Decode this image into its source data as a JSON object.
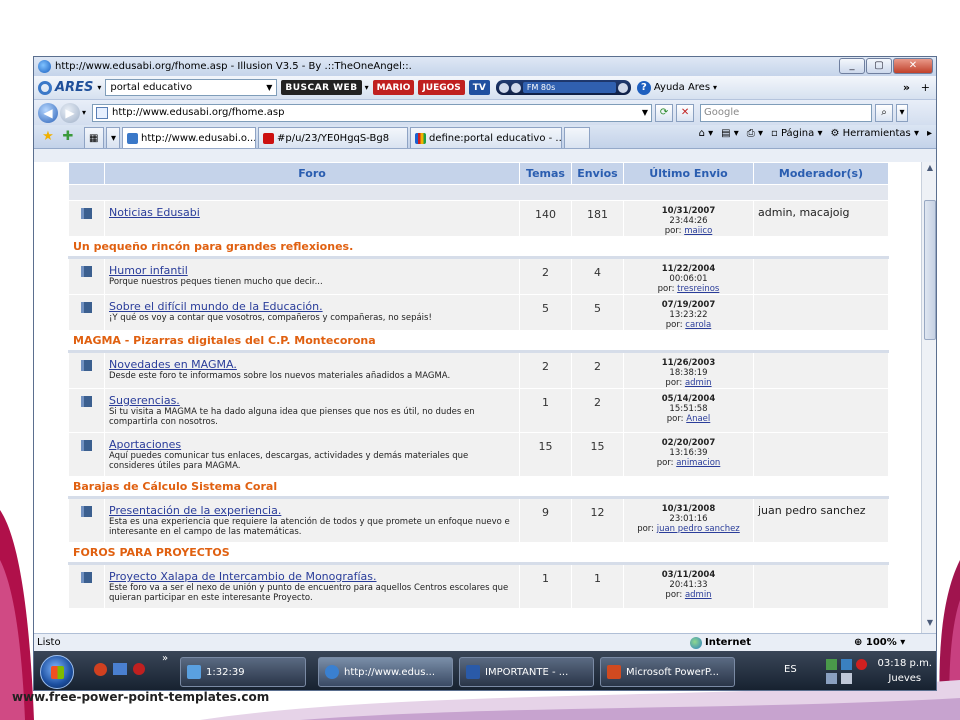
{
  "window": {
    "title": "http://www.edusabi.org/fhome.asp - Illusion V3.5 - By .::TheOneAngel::.",
    "controls": [
      "_",
      "▢",
      "✕"
    ]
  },
  "ares_toolbar": {
    "logo": "ARES",
    "search_value": "portal educativo",
    "buscar_label": "BUSCAR WEB",
    "mario_label": "MARIO",
    "juegos_label": "JUEGOS",
    "tv_label": "TV",
    "radio_station": "FM 80s",
    "help_label": "Ayuda Ares"
  },
  "address_bar": {
    "url": "http://www.edusabi.org/fhome.asp",
    "search_placeholder": "Google"
  },
  "tabs": [
    {
      "label": "http://www.edusabi.o...",
      "active": true
    },
    {
      "label": "#p/u/23/YE0HgqS-Bg8",
      "active": false
    },
    {
      "label": "define:portal educativo - ...",
      "active": false
    }
  ],
  "command_bar": {
    "page_label": "Página",
    "tools_label": "Herramientas"
  },
  "forum": {
    "headers": {
      "forum": "Foro",
      "topics": "Temas",
      "posts": "Envios",
      "last": "Último Envio",
      "moderator": "Moderador(s)"
    },
    "rows": [
      {
        "type": "forum",
        "title": "Noticias Edusabi",
        "desc": "",
        "topics": "140",
        "posts": "181",
        "date": "10/31/2007",
        "time": "23:44:26",
        "by_prefix": "por:",
        "by": "maiico",
        "moderator": "admin, macajoig"
      },
      {
        "type": "category",
        "title": "Un pequeño rincón para grandes reflexiones."
      },
      {
        "type": "forum",
        "title": "Humor infantil",
        "desc": "Porque nuestros peques tienen mucho que decir...",
        "topics": "2",
        "posts": "4",
        "date": "11/22/2004",
        "time": "00:06:01",
        "by_prefix": "por:",
        "by": "tresreinos",
        "moderator": ""
      },
      {
        "type": "forum",
        "title": "Sobre el difícil mundo de la Educación.",
        "desc": "¡Y qué os voy a contar que vosotros, compañeros y compañeras, no sepáis!",
        "topics": "5",
        "posts": "5",
        "date": "07/19/2007",
        "time": "13:23:22",
        "by_prefix": "por:",
        "by": "carola",
        "moderator": ""
      },
      {
        "type": "category",
        "title": "MAGMA - Pizarras digitales del C.P. Montecorona"
      },
      {
        "type": "forum",
        "title": "Novedades en MAGMA.",
        "desc": "Desde este foro te informamos sobre los nuevos materiales añadidos a MAGMA.",
        "topics": "2",
        "posts": "2",
        "date": "11/26/2003",
        "time": "18:38:19",
        "by_prefix": "por:",
        "by": "admin",
        "moderator": ""
      },
      {
        "type": "forum",
        "title": "Sugerencias.",
        "desc": "Si tu visita a MAGMA te ha dado alguna idea que pienses que nos es útil, no dudes en compartirla con nosotros.",
        "topics": "1",
        "posts": "2",
        "date": "05/14/2004",
        "time": "15:51:58",
        "by_prefix": "por:",
        "by": "Anael",
        "moderator": ""
      },
      {
        "type": "forum",
        "title": "Aportaciones",
        "desc": "Aquí puedes comunicar tus enlaces, descargas, actividades y demás materiales que consideres útiles para MAGMA.",
        "topics": "15",
        "posts": "15",
        "date": "02/20/2007",
        "time": "13:16:39",
        "by_prefix": "por:",
        "by": "animacion",
        "moderator": ""
      },
      {
        "type": "category",
        "title": "Barajas de Cálculo Sistema Coral"
      },
      {
        "type": "forum",
        "title": "Presentación de la experiencia.",
        "desc": "Esta es una experiencia que requiere la atención de todos y que promete un enfoque nuevo e interesante en el campo de las matemáticas.",
        "topics": "9",
        "posts": "12",
        "date": "10/31/2008",
        "time": "23:01:16",
        "by_prefix": "por:",
        "by": "juan pedro sanchez",
        "moderator": "juan pedro sanchez"
      },
      {
        "type": "category",
        "title": "FOROS PARA PROYECTOS"
      },
      {
        "type": "forum",
        "title": "Proyecto Xalapa de Intercambio de Monografías.",
        "desc": "Este foro va a ser el nexo de unión y punto de encuentro para aquellos Centros escolares que quieran participar en este interesante Proyecto.",
        "topics": "1",
        "posts": "1",
        "date": "03/11/2004",
        "time": "20:41:33",
        "by_prefix": "por:",
        "by": "admin",
        "moderator": ""
      }
    ]
  },
  "status": {
    "left": "Listo",
    "zone": "Internet",
    "zoom": "100%"
  },
  "taskbar": {
    "items": [
      {
        "label": "1:32:39"
      },
      {
        "label": "http://www.edus..."
      },
      {
        "label": "IMPORTANTE - ..."
      },
      {
        "label": "Microsoft PowerP..."
      }
    ],
    "lang": "ES",
    "time": "03:18 p.m.",
    "day": "Jueves"
  },
  "footer": {
    "url": "www.free-power-point-templates.com"
  }
}
